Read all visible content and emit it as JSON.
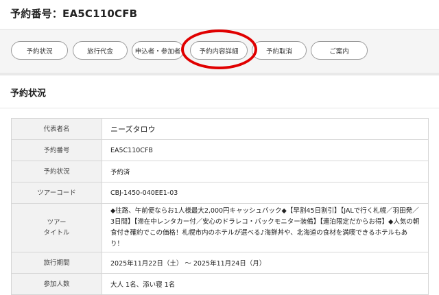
{
  "header": {
    "title": "予約番号：EA5C110CFB"
  },
  "tabs": [
    {
      "label": "予約状況"
    },
    {
      "label": "旅行代金"
    },
    {
      "label": "申込者・参加者"
    },
    {
      "label": "予約内容詳細"
    },
    {
      "label": "予約取消"
    },
    {
      "label": "ご案内"
    }
  ],
  "highlight_color": "#e00000",
  "section": {
    "title": "予約状況"
  },
  "details": {
    "representative": {
      "label": "代表者名",
      "value": "ニーズタロウ"
    },
    "booking_number": {
      "label": "予約番号",
      "value": "EA5C110CFB"
    },
    "status": {
      "label": "予約状況",
      "value": "予約済"
    },
    "tour_code": {
      "label": "ツアーコード",
      "value": "CBJ-1450-040EE1-03"
    },
    "tour_title": {
      "label_line1": "ツアー",
      "label_line2": "タイトル",
      "value": "◆往路、午前便ならお1人様最大2,000円キャッシュバック◆【早割45日割引】【JALで行く札幌／羽田発／3日間】【滞在中レンタカー付／安心のドラレコ・バックモニター装備】【連泊限定だからお得】◆人気の朝食付き確約でこの価格！札幌市内のホテルが選べる♪海鮮丼や、北海道の食材を満喫できるホテルもあり！"
    },
    "travel_period": {
      "label": "旅行期間",
      "value": "2025年11月22日（土） ～ 2025年11月24日（月）"
    },
    "participants": {
      "label": "参加人数",
      "value": "大人 1名、添い寝 1名"
    }
  }
}
